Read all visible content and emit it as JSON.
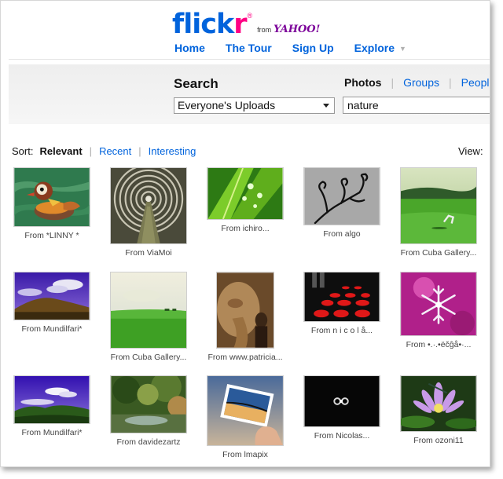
{
  "brand": {
    "name_a": "flick",
    "name_b": "r",
    "reg": "®",
    "from": "from",
    "yahoo": "YAHOO!"
  },
  "nav": {
    "home": "Home",
    "tour": "The Tour",
    "signup": "Sign Up",
    "explore": "Explore",
    "explore_chev": "▼"
  },
  "search": {
    "title": "Search",
    "tabs": [
      "Photos",
      "Groups",
      "People"
    ],
    "scope": "Everyone's Uploads",
    "query": "nature"
  },
  "sort": {
    "label": "Sort:",
    "options": [
      "Relevant",
      "Recent",
      "Interesting"
    ],
    "view_label": "View:"
  },
  "photos": [
    {
      "caption": "From *LINNY *",
      "subject": "mandarin-duck"
    },
    {
      "caption": "From ViaMoi",
      "subject": "tunnel-rings"
    },
    {
      "caption": "From ichiro...",
      "subject": "green-leaf-droplets"
    },
    {
      "caption": "From algo",
      "subject": "plant-silhouette"
    },
    {
      "caption": "From Cuba Gallery...",
      "subject": "green-field-dog"
    },
    {
      "caption": "From Mundilfari*",
      "subject": "purple-sky-hill"
    },
    {
      "caption": "From Cuba Gallery...",
      "subject": "green-meadow"
    },
    {
      "caption": "From www.patricia...",
      "subject": "elephant-woman"
    },
    {
      "caption": "From n i c o l å...",
      "subject": "red-dots-path"
    },
    {
      "caption": "From •.·.•ëčĝå•·...",
      "subject": "snowflake-magenta"
    },
    {
      "caption": "From Mundilfari*",
      "subject": "purple-sky-mountain"
    },
    {
      "caption": "From davidezartz",
      "subject": "garden-pond"
    },
    {
      "caption": "From lmapix",
      "subject": "hand-holding-photo"
    },
    {
      "caption": "From Nicolas...",
      "subject": "dark-rings"
    },
    {
      "caption": "From ozoni11",
      "subject": "purple-lotus"
    }
  ]
}
